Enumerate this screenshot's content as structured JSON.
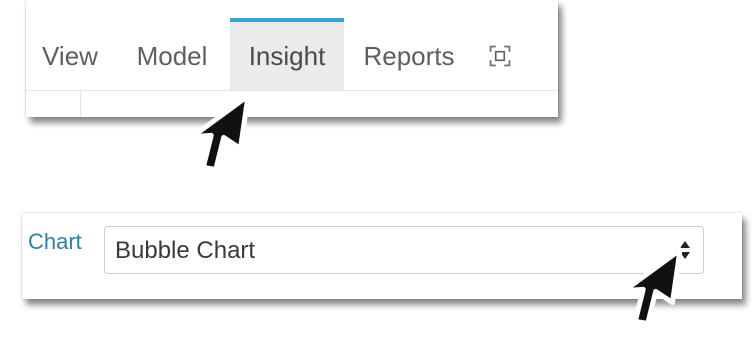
{
  "tabs": [
    {
      "label": "View"
    },
    {
      "label": "Model"
    },
    {
      "label": "Insight",
      "active": true
    },
    {
      "label": "Reports"
    }
  ],
  "tab_expand_icon": "expand-icon",
  "active_tab_accent": "#3aa3d6",
  "chart_field": {
    "label": "Chart",
    "selected_value": "Bubble Chart",
    "label_color": "#2f7fa3"
  },
  "cursor_icon": "arrow-cursor-icon"
}
